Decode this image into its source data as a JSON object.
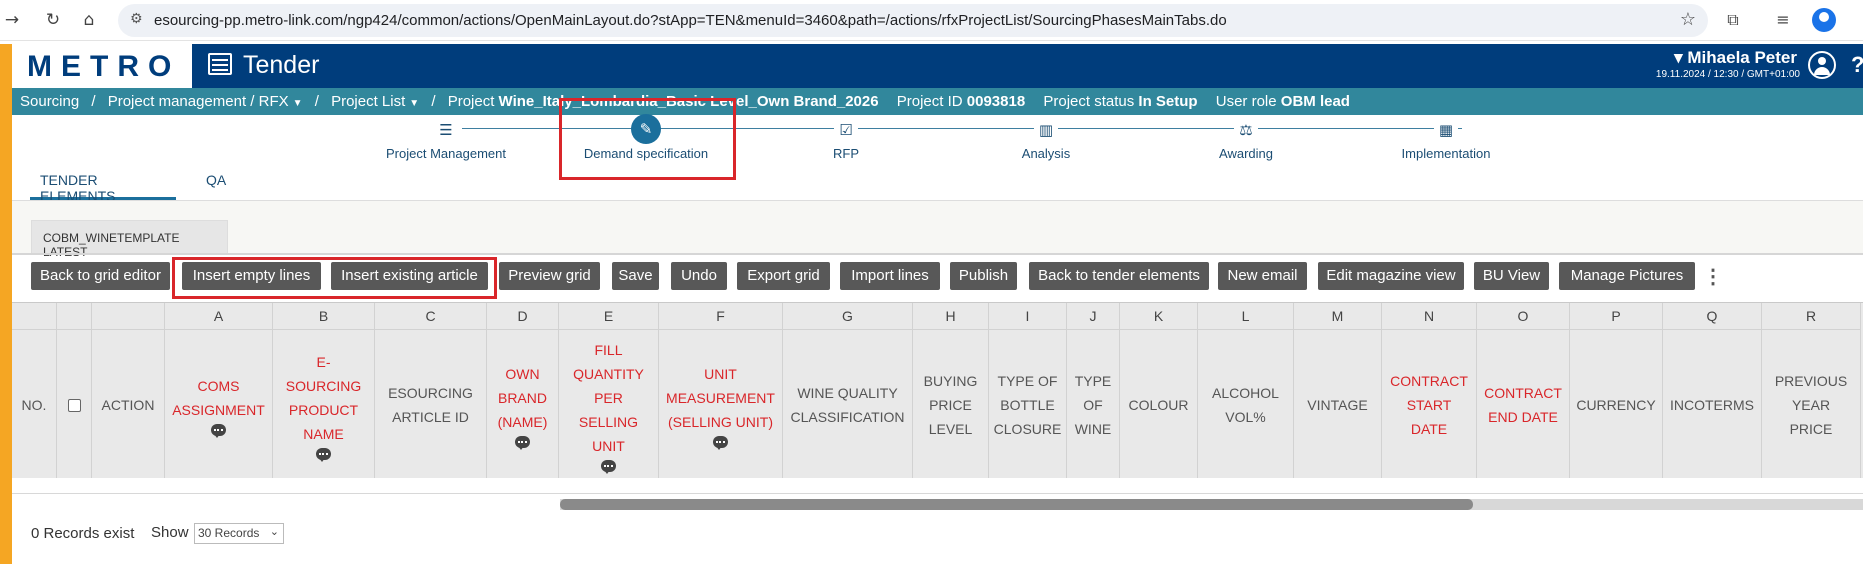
{
  "browser": {
    "url": "esourcing-pp.metro-link.com/ngp424/common/actions/OpenMainLayout.do?stApp=TEN&menuId=3460&path=/actions/rfxProjectList/SourcingPhasesMainTabs.do"
  },
  "header": {
    "logo": "METRO",
    "app_title": "Tender",
    "user_name": "Mihaela Peter",
    "user_date": "19.11.2024 / 12:30 / GMT+01:00"
  },
  "breadcrumb": {
    "sourcing": "Sourcing",
    "project_management": "Project management / RFX",
    "project_list": "Project List",
    "project_label": "Project",
    "project_name": "Wine_Italy_Lombardia_Basic Level_Own Brand_2026",
    "project_id_label": "Project ID",
    "project_id": "0093818",
    "status_label": "Project status",
    "status": "In Setup",
    "role_label": "User role",
    "role": "OBM lead"
  },
  "steps": [
    {
      "label": "Project Management",
      "icon": "list-icon"
    },
    {
      "label": "Demand specification",
      "icon": "pencil-icon"
    },
    {
      "label": "RFP",
      "icon": "checkbox-icon"
    },
    {
      "label": "Analysis",
      "icon": "bar-chart-icon"
    },
    {
      "label": "Awarding",
      "icon": "award-icon"
    },
    {
      "label": "Implementation",
      "icon": "calendar-icon"
    }
  ],
  "tabs": {
    "tender_elements": "TENDER ELEMENTS",
    "qa": "QA"
  },
  "template_tab": "COBM_WINETEMPLATE LATEST",
  "toolbar": {
    "back_to_grid_editor": "Back to grid editor",
    "insert_empty_lines": "Insert empty lines",
    "insert_existing_article": "Insert existing article",
    "preview_grid": "Preview grid",
    "save": "Save",
    "undo": "Undo",
    "export_grid": "Export grid",
    "import_lines": "Import lines",
    "publish": "Publish",
    "back_to_tender_elements": "Back to tender elements",
    "new_email": "New email",
    "edit_magazine_view": "Edit magazine view",
    "bu_view": "BU View",
    "manage_pictures": "Manage Pictures"
  },
  "grid": {
    "no_label": "NO.",
    "action_label": "ACTION",
    "columns": [
      {
        "letter": "A",
        "lines": [
          "COMS",
          "ASSIGNMENT"
        ],
        "required": true,
        "comment": true
      },
      {
        "letter": "B",
        "lines": [
          "E-",
          "SOURCING",
          "PRODUCT",
          "NAME"
        ],
        "required": true,
        "comment": true
      },
      {
        "letter": "C",
        "lines": [
          "ESOURCING",
          "ARTICLE ID"
        ],
        "required": false,
        "comment": false
      },
      {
        "letter": "D",
        "lines": [
          "OWN",
          "BRAND",
          "(NAME)"
        ],
        "required": true,
        "comment": true
      },
      {
        "letter": "E",
        "lines": [
          "FILL",
          "QUANTITY",
          "PER",
          "SELLING",
          "UNIT"
        ],
        "required": true,
        "comment": true
      },
      {
        "letter": "F",
        "lines": [
          "UNIT",
          "MEASUREMENT",
          "(SELLING UNIT)"
        ],
        "required": true,
        "comment": true
      },
      {
        "letter": "G",
        "lines": [
          "WINE QUALITY",
          "CLASSIFICATION"
        ],
        "required": false,
        "comment": false
      },
      {
        "letter": "H",
        "lines": [
          "BUYING",
          "PRICE",
          "LEVEL"
        ],
        "required": false,
        "comment": false
      },
      {
        "letter": "I",
        "lines": [
          "TYPE OF",
          "BOTTLE",
          "CLOSURE"
        ],
        "required": false,
        "comment": false
      },
      {
        "letter": "J",
        "lines": [
          "TYPE",
          "OF",
          "WINE"
        ],
        "required": false,
        "comment": false
      },
      {
        "letter": "K",
        "lines": [
          "COLOUR"
        ],
        "required": false,
        "comment": false
      },
      {
        "letter": "L",
        "lines": [
          "ALCOHOL",
          "VOL%"
        ],
        "required": false,
        "comment": false
      },
      {
        "letter": "M",
        "lines": [
          "VINTAGE"
        ],
        "required": false,
        "comment": false
      },
      {
        "letter": "N",
        "lines": [
          "CONTRACT",
          "START",
          "DATE"
        ],
        "required": true,
        "comment": false
      },
      {
        "letter": "O",
        "lines": [
          "CONTRACT",
          "END DATE"
        ],
        "required": true,
        "comment": false
      },
      {
        "letter": "P",
        "lines": [
          "CURRENCY"
        ],
        "required": false,
        "comment": false
      },
      {
        "letter": "Q",
        "lines": [
          "INCOTERMS"
        ],
        "required": false,
        "comment": false
      },
      {
        "letter": "R",
        "lines": [
          "PREVIOUS",
          "YEAR",
          "PRICE"
        ],
        "required": false,
        "comment": false
      }
    ]
  },
  "footer": {
    "records": "0 Records exist",
    "show_label": "Show",
    "show_value": "30 Records"
  }
}
